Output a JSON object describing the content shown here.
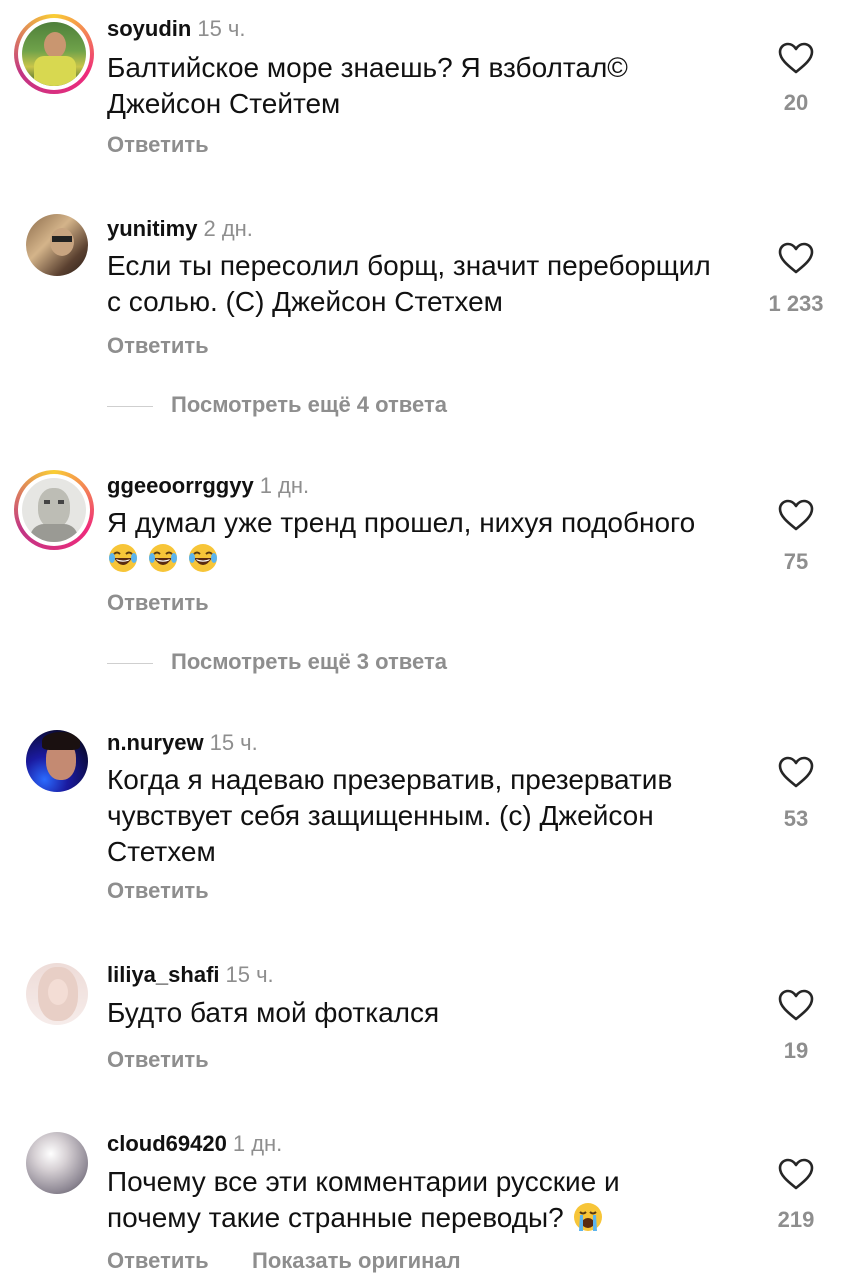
{
  "reply_label": "Ответить",
  "show_original_label": "Показать оригинал",
  "comments": [
    {
      "username": "soyudin",
      "time": "15 ч.",
      "line1": "Балтийское море знаешь? Я взболтал©",
      "line2": "Джейсон Стейтем",
      "likes": "20"
    },
    {
      "username": "yunitimy",
      "time": "2 дн.",
      "line1": "Если ты пересолил борщ, значит переборщил",
      "line2": "с солью. (С) Джейсон Стетхем",
      "likes": "1 233"
    },
    {
      "username": "ggeeoorrggyy",
      "time": "1 дн.",
      "line1": "Я думал уже тренд прошел, нихуя подобного",
      "likes": "75"
    },
    {
      "username": "n.nuryew",
      "time": "15 ч.",
      "line1": "Когда я надеваю презерватив, презерватив",
      "line2": "чувствует себя защищенным. (с) Джейсон",
      "line3": "Стетхем",
      "likes": "53"
    },
    {
      "username": "liliya_shafi",
      "time": "15 ч.",
      "line1": "Будто батя мой фоткался",
      "likes": "19"
    },
    {
      "username": "cloud69420",
      "time": "1 дн.",
      "line1": "Почему все эти комментарии русские и",
      "line2": "почему такие странные переводы?",
      "likes": "219"
    }
  ],
  "more_replies": [
    {
      "label": "Посмотреть ещё 4 ответа"
    },
    {
      "label": "Посмотреть ещё 3 ответа"
    }
  ],
  "colors": {
    "muted": "#8e8e8e",
    "text": "#111111",
    "ring_start": "#f9ce34",
    "ring_end": "#c13584"
  },
  "icons": {
    "like": "heart-outline-icon",
    "emoji_laugh": "face-with-tears-of-joy",
    "emoji_cry": "loudly-crying-face"
  }
}
